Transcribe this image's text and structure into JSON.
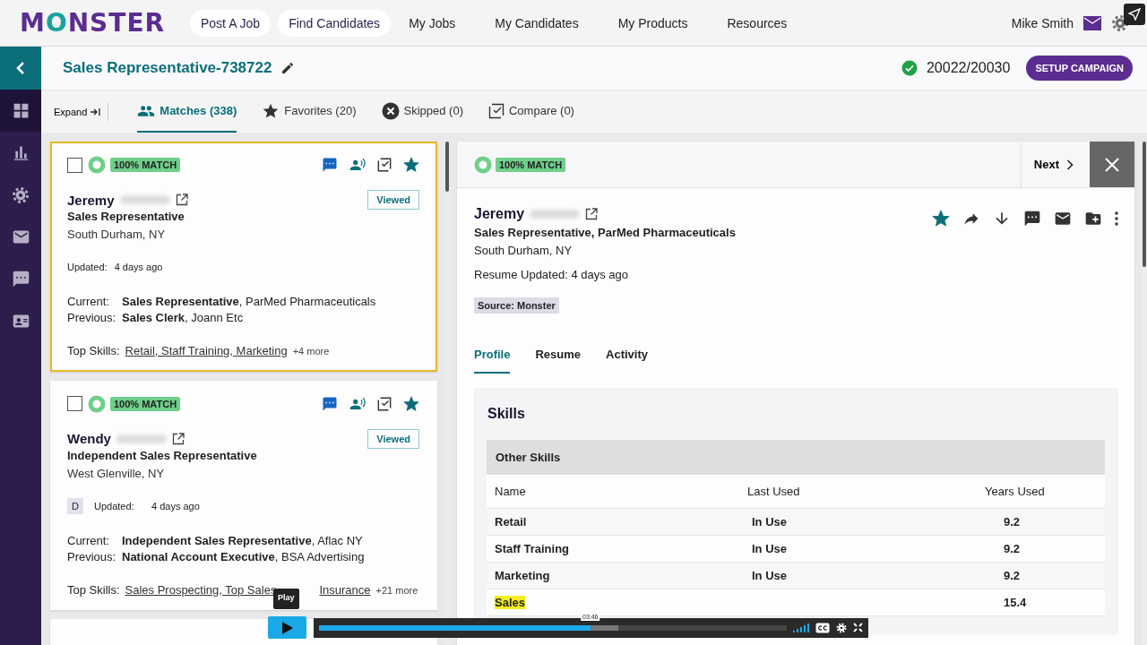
{
  "nav": {
    "logo": "MONSTER",
    "links": [
      {
        "label": "Post A Job",
        "highlighted": true
      },
      {
        "label": "Find Candidates",
        "highlighted": true
      },
      {
        "label": "My Jobs",
        "highlighted": false
      },
      {
        "label": "My Candidates",
        "highlighted": false
      },
      {
        "label": "My Products",
        "highlighted": false
      },
      {
        "label": "Resources",
        "highlighted": false
      }
    ],
    "user": "Mike Smith"
  },
  "sidebar": {
    "items": [
      {
        "kind": "back",
        "selected": false
      },
      {
        "kind": "grid",
        "selected": true
      },
      {
        "kind": "chart",
        "selected": false
      },
      {
        "kind": "gear",
        "selected": false
      },
      {
        "kind": "mail",
        "selected": false
      },
      {
        "kind": "chat",
        "selected": false
      },
      {
        "kind": "contact",
        "selected": false
      }
    ]
  },
  "header": {
    "title": "Sales Representative-738722",
    "credits": "20022/20030",
    "campaign_button": "SETUP CAMPAIGN"
  },
  "toolbar": {
    "expand": "Expand",
    "tabs": [
      {
        "kind": "people",
        "label": "Matches (338)",
        "selected": true
      },
      {
        "kind": "star",
        "label": "Favorites (20)",
        "selected": false
      },
      {
        "kind": "skip",
        "label": "Skipped (0)",
        "selected": false
      },
      {
        "kind": "compare",
        "label": "Compare (0)",
        "selected": false
      }
    ]
  },
  "candidates": [
    {
      "first_name": "Jeremy",
      "title": "Sales Representative",
      "location": "South Durham, NY",
      "updated_label": "Updated:",
      "updated": "4 days ago",
      "current_label": "Current:",
      "current": "**Sales Representative**, ParMed Pharmaceuticals",
      "previous_label": "Previous:",
      "previous": "**Sales Clerk**, Joann Etc",
      "skills_label": "Top Skills:",
      "skills": [
        "Retail, Staff Training, Marketing"
      ],
      "more": "+4 more",
      "match": "100% MATCH",
      "status": "Viewed",
      "checked": false,
      "favorite": true,
      "focused": true
    },
    {
      "first_name": "Wendy",
      "title": "Independent Sales Representative",
      "location": "West Glenville, NY",
      "initial": "D",
      "updated_label": "Updated:",
      "updated": "4 days ago",
      "current_label": "Current:",
      "current": "**Independent Sales Representative**, Aflac NY",
      "previous_label": "Previous:",
      "previous": "**National Account Executive**, BSA Advertising",
      "skills_label": "Top Skills:",
      "skills": [
        "Sales Prospecting, Top Sales",
        "Insurance"
      ],
      "more": "+21 more",
      "match": "100% MATCH",
      "status": "Viewed",
      "checked": false,
      "favorite": true,
      "focused": false
    }
  ],
  "detail": {
    "match": "100% MATCH",
    "next": "Next",
    "first_name": "Jeremy",
    "title": "Sales Representative, ParMed Pharmaceuticals",
    "location": "South Durham, NY",
    "resume_updated": "Resume Updated: 4 days ago",
    "source": "Source: Monster",
    "favorite": true,
    "tabs": [
      {
        "label": "Profile",
        "selected": true
      },
      {
        "label": "Resume",
        "selected": false
      },
      {
        "label": "Activity",
        "selected": false
      }
    ],
    "skills": {
      "title": "Skills",
      "group": "Other Skills",
      "columns": [
        "Name",
        "Last Used",
        "Years Used"
      ],
      "rows": [
        {
          "name": "Retail",
          "last_used": "In Use",
          "years": "9.2",
          "highlighted": false
        },
        {
          "name": "Staff Training",
          "last_used": "In Use",
          "years": "9.2",
          "highlighted": false
        },
        {
          "name": "Marketing",
          "last_used": "In Use",
          "years": "9.2",
          "highlighted": false
        },
        {
          "name": "Sales",
          "years": "15.4",
          "highlighted": true
        }
      ]
    }
  },
  "video": {
    "tooltip": "Play",
    "time": "03:46",
    "level": 0.58
  }
}
